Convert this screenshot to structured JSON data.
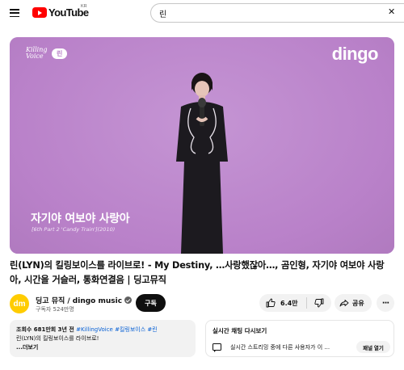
{
  "header": {
    "logo_text": "YouTube",
    "region": "KR",
    "search_value": "린",
    "icons": {
      "menu": "hamburger-menu-icon",
      "logo": "youtube-logo-icon",
      "clear": "close-icon"
    }
  },
  "player": {
    "badge_series": "Killing Voice",
    "badge_name": "린",
    "brand": "dingo",
    "overlay_title": "자기야 여보야 사랑아",
    "overlay_subtitle": "[6th Part 2 'Candy Train'](2010)",
    "colors": {
      "background": "#bd87cd"
    }
  },
  "video": {
    "title": "린(LYN)의 킬링보이스를 라이브로! - My Destiny, …사랑했잖아…, 곰인형, 자기야 여보야 사랑아, 시간을 거슬러, 통화연결음 | 딩고뮤직"
  },
  "channel": {
    "avatar_text": "dm",
    "name": "딩고 뮤직 / dingo music",
    "subscribers": "구독자 524만명",
    "subscribe_label": "구독",
    "verified_icon": "verified-check-icon",
    "avatar_color": "#ffcc00"
  },
  "actions": {
    "like_count": "6.4만",
    "share_label": "공유",
    "more_label": "···",
    "icons": {
      "like": "thumbs-up-icon",
      "dislike": "thumbs-down-icon",
      "share": "share-arrow-icon",
      "more": "more-horizontal-icon"
    }
  },
  "description": {
    "stats": "조회수 681만회  3년 전",
    "tags": "#KillingVoice #킬링보이스 #린",
    "preview": "린(LYN)의 킬링보이스를 라이브로!",
    "more_label": "...더보기"
  },
  "live_chat": {
    "title": "실시간 채팅 다시보기",
    "message": "실시간 스트리밍 중에 다른 사용자가 이 ...",
    "button_label": "패널 열기",
    "icon": "chat-bubble-icon"
  }
}
